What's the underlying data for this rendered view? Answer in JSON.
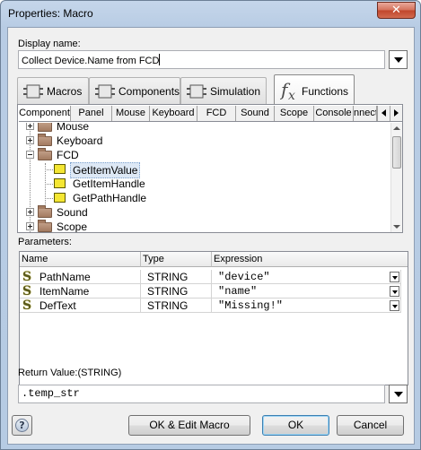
{
  "window": {
    "title": "Properties: Macro",
    "close_glyph": "✕"
  },
  "display_name": {
    "label": "Display name:",
    "value": "Collect Device.Name from FCD"
  },
  "tabs": [
    {
      "label": "Macros",
      "icon": "macros-icon"
    },
    {
      "label": "Components",
      "icon": "components-icon"
    },
    {
      "label": "Simulation",
      "icon": "simulation-icon"
    },
    {
      "label": "Functions",
      "icon": "fx-icon",
      "active": true
    }
  ],
  "subtabs": [
    "Component",
    "Panel",
    "Mouse",
    "Keyboard",
    "FCD",
    "Sound",
    "Scope",
    "Console",
    "nnect"
  ],
  "tree": {
    "items": [
      {
        "label": "Mouse",
        "type": "folder",
        "expanded": false
      },
      {
        "label": "Keyboard",
        "type": "folder",
        "expanded": false
      },
      {
        "label": "FCD",
        "type": "folder",
        "expanded": true
      },
      {
        "label": "GetItemValue",
        "type": "function",
        "selected": true
      },
      {
        "label": "GetItemHandle",
        "type": "function"
      },
      {
        "label": "GetPathHandle",
        "type": "function"
      },
      {
        "label": "Sound",
        "type": "folder",
        "expanded": false
      },
      {
        "label": "Scope",
        "type": "folder",
        "expanded": false
      }
    ]
  },
  "parameters": {
    "label": "Parameters:",
    "columns": [
      "Name",
      "Type",
      "Expression"
    ],
    "rows": [
      {
        "name": "PathName",
        "type": "STRING",
        "expression": "\"device\""
      },
      {
        "name": "ItemName",
        "type": "STRING",
        "expression": "\"name\""
      },
      {
        "name": "DefText",
        "type": "STRING",
        "expression": "\"Missing!\""
      }
    ]
  },
  "return_value": {
    "label": "Return Value:(STRING)",
    "value": ".temp_str"
  },
  "buttons": {
    "help": "?",
    "ok_edit": "OK & Edit Macro",
    "ok": "OK",
    "cancel": "Cancel"
  },
  "colors": {
    "accent": "#3c7fb1",
    "selection": "#dde8f5",
    "function_icon": "#f4e633"
  }
}
